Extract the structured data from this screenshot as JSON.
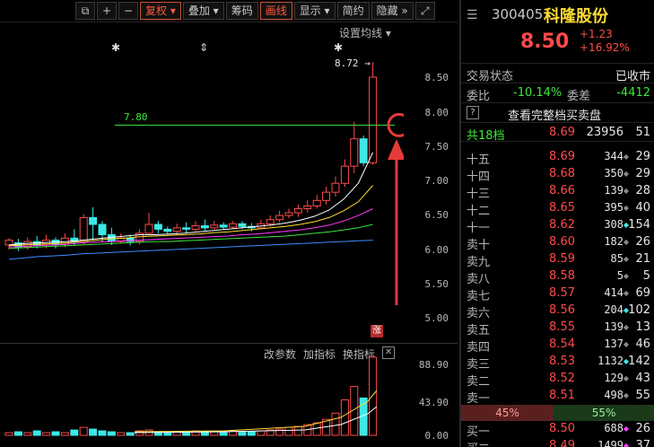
{
  "toolbar": {
    "items": [
      {
        "label": "⧉",
        "kind": "icon",
        "name": "window-icon"
      },
      {
        "label": "+",
        "kind": "icon",
        "name": "zoom-in-icon"
      },
      {
        "label": "−",
        "kind": "icon",
        "name": "zoom-out-icon"
      },
      {
        "label": "复权 ▾",
        "kind": "active",
        "name": "fuquan-button"
      },
      {
        "label": "叠加 ▾",
        "kind": "btn",
        "name": "overlay-button"
      },
      {
        "label": "筹码",
        "kind": "btn",
        "name": "chips-button"
      },
      {
        "label": "画线",
        "kind": "active",
        "name": "draw-line-button"
      },
      {
        "label": "显示 ▾",
        "kind": "btn",
        "name": "display-button"
      },
      {
        "label": "简约",
        "kind": "btn",
        "name": "simple-button"
      },
      {
        "label": "隐藏 »",
        "kind": "btn",
        "name": "hide-button"
      },
      {
        "label": "⤢",
        "kind": "icon",
        "name": "fullscreen-icon"
      }
    ]
  },
  "chart": {
    "ma_settings_label": "设置均线 ▾",
    "max_price_label": "8.72",
    "hline_label": "7.80",
    "limit_badge": "涨",
    "price_ticks": [
      "8.50",
      "8.00",
      "7.50",
      "7.00",
      "6.50",
      "6.00",
      "5.50",
      "5.00"
    ],
    "volume_ticks": [
      "88.90",
      "43.90",
      "0.00"
    ],
    "indicator_bar": {
      "change_params": "改参数",
      "add_indicator": "加指标",
      "switch_indicator": "换指标",
      "close": "✕"
    }
  },
  "quote": {
    "code": "300405",
    "name": "科隆股份",
    "price": "8.50",
    "change_abs": "+1.23",
    "change_pct": "+16.92%",
    "trade_status_label": "交易状态",
    "trade_status_value": "已收市",
    "weibi_label": "委比",
    "weibi_value": "-10.14%",
    "weicha_label": "委差",
    "weicha_value": "-4412",
    "full_book_label": "查看完整档买卖盘",
    "book_header": {
      "label": "共18档",
      "price": "8.69",
      "vol": "23956",
      "count": "51"
    },
    "asks": [
      {
        "label": "十五",
        "price": "8.69",
        "vol": "344",
        "count": "29",
        "dot": "gray"
      },
      {
        "label": "十四",
        "price": "8.68",
        "vol": "350",
        "count": "29",
        "dot": "gray"
      },
      {
        "label": "十三",
        "price": "8.66",
        "vol": "139",
        "count": "28",
        "dot": "gray"
      },
      {
        "label": "十二",
        "price": "8.65",
        "vol": "395",
        "count": "40",
        "dot": "gray"
      },
      {
        "label": "十一",
        "price": "8.62",
        "vol": "308",
        "count": "154",
        "dot": "cyan"
      },
      {
        "label": "卖十",
        "price": "8.60",
        "vol": "182",
        "count": "26",
        "dot": "gray"
      },
      {
        "label": "卖九",
        "price": "8.59",
        "vol": "85",
        "count": "21",
        "dot": "gray"
      },
      {
        "label": "卖八",
        "price": "8.58",
        "vol": "5",
        "count": "5",
        "dot": "gray"
      },
      {
        "label": "卖七",
        "price": "8.57",
        "vol": "414",
        "count": "69",
        "dot": "gray"
      },
      {
        "label": "卖六",
        "price": "8.56",
        "vol": "204",
        "count": "102",
        "dot": "cyan"
      },
      {
        "label": "卖五",
        "price": "8.55",
        "vol": "139",
        "count": "13",
        "dot": "gray"
      },
      {
        "label": "卖四",
        "price": "8.54",
        "vol": "137",
        "count": "46",
        "dot": "gray"
      },
      {
        "label": "卖三",
        "price": "8.53",
        "vol": "1132",
        "count": "142",
        "dot": "cyan"
      },
      {
        "label": "卖二",
        "price": "8.52",
        "vol": "129",
        "count": "43",
        "dot": "gray"
      },
      {
        "label": "卖一",
        "price": "8.51",
        "vol": "498",
        "count": "55",
        "dot": "gray"
      }
    ],
    "ratio_left": "45%",
    "ratio_right": "55%",
    "ratio_left_value": 0.45,
    "bids": [
      {
        "label": "买一",
        "price": "8.50",
        "vol": "688",
        "count": "26",
        "dot": "magenta"
      },
      {
        "label": "买二",
        "price": "8.49",
        "vol": "1499",
        "count": "37",
        "dot": "magenta"
      }
    ]
  },
  "colors": {
    "up": "#ff4a4a",
    "down": "#3ce8e8",
    "hline": "#3ce83c",
    "highlight": "#e63a3a"
  }
}
